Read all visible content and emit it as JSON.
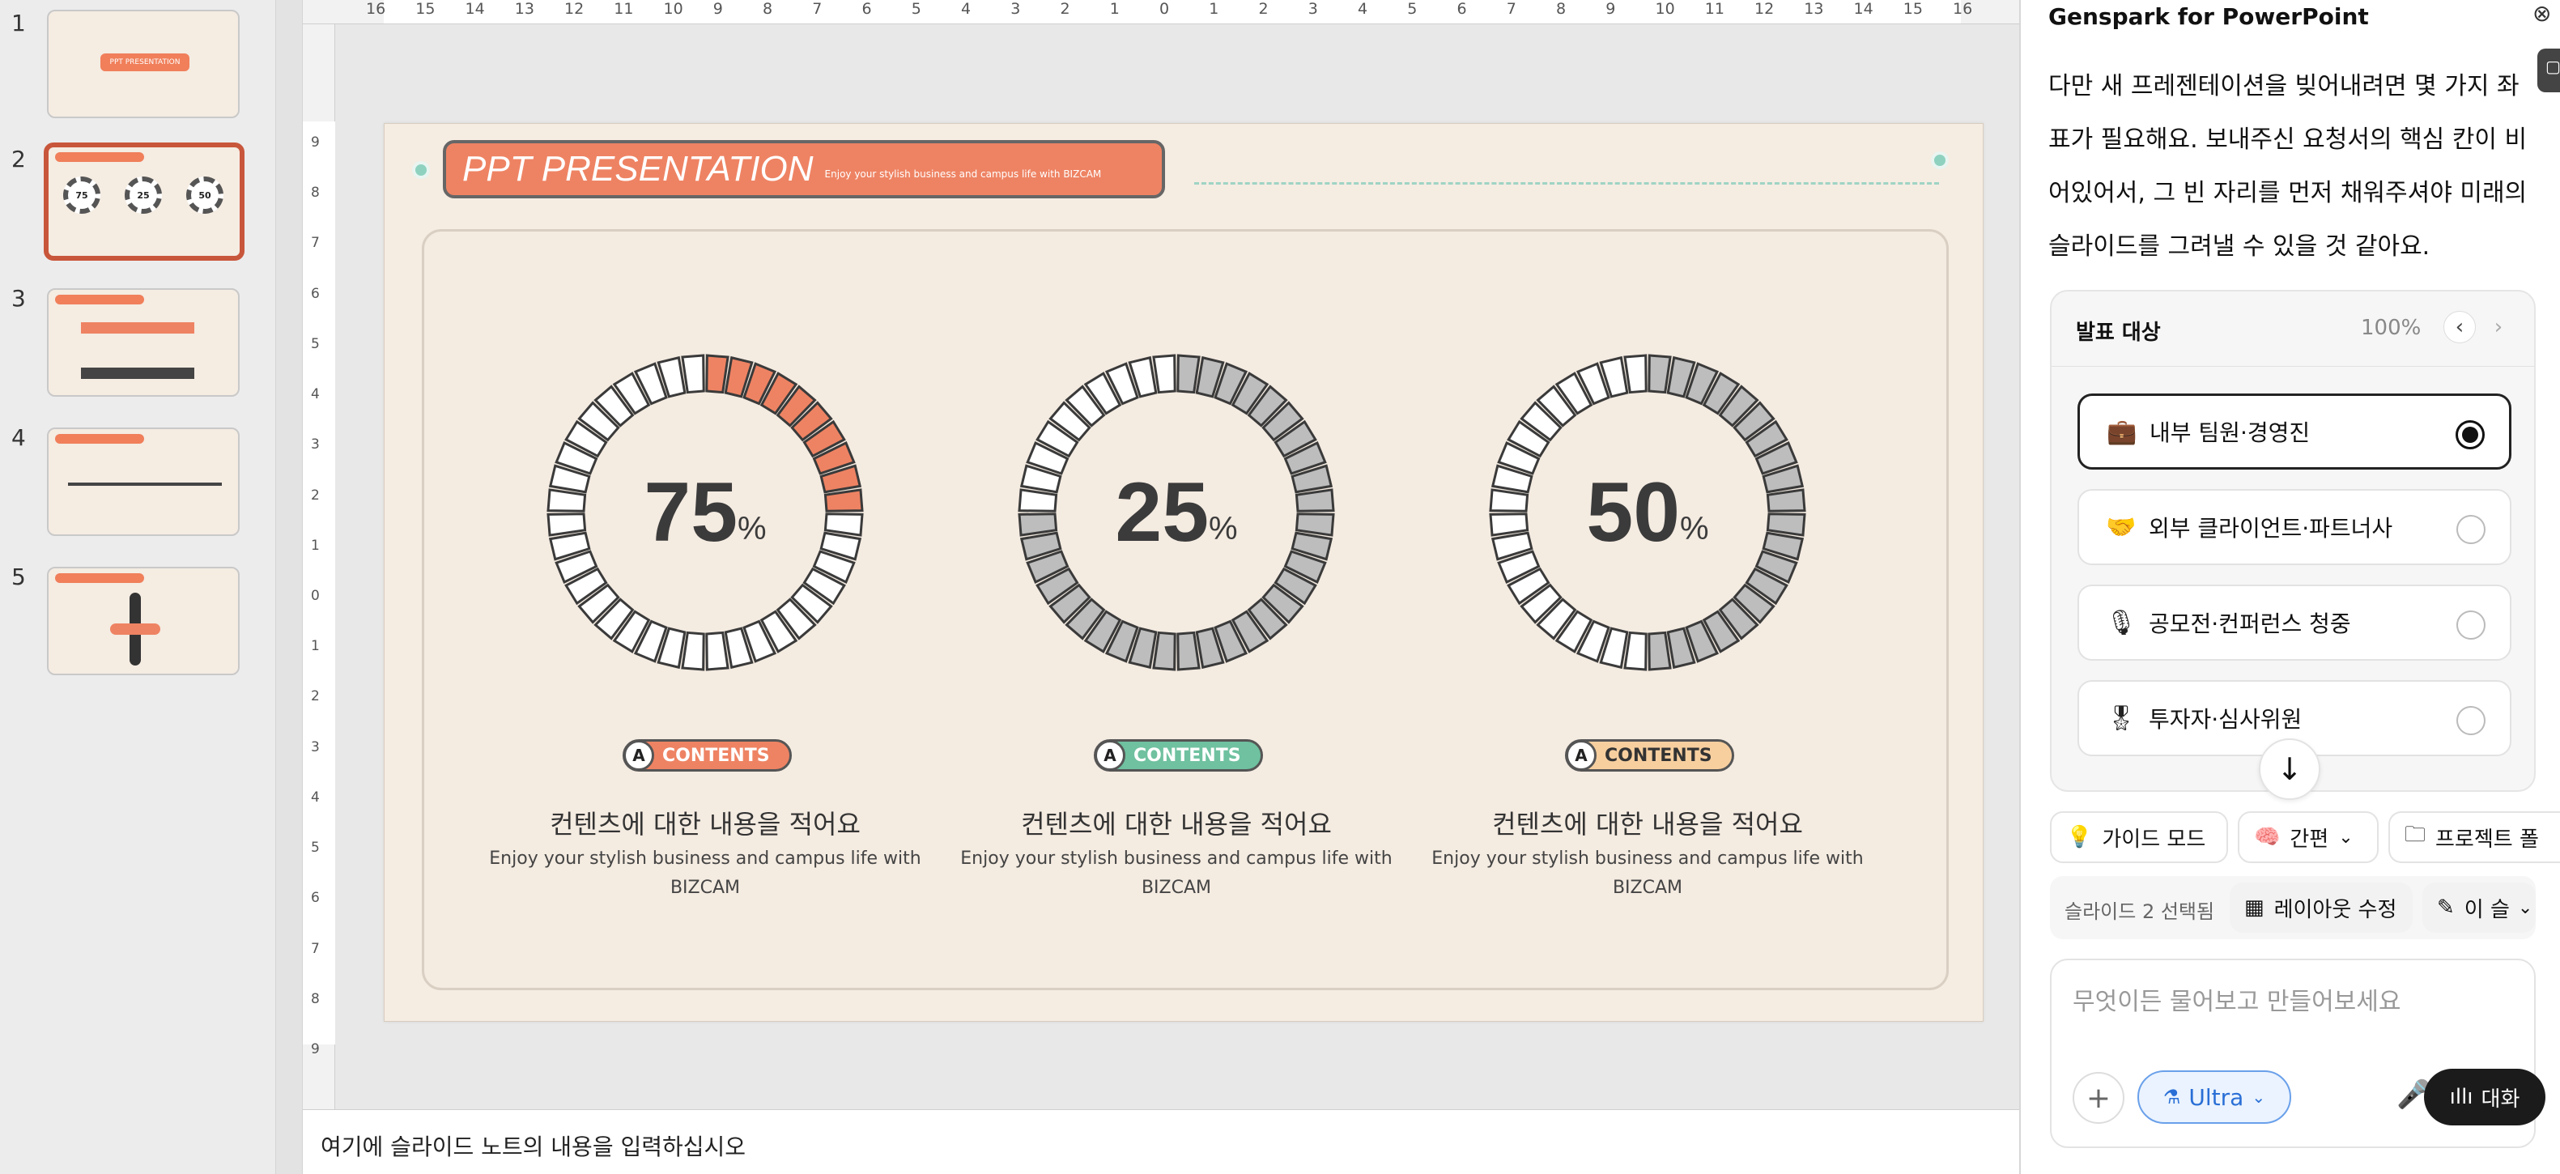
{
  "thumbnails": [
    {
      "number": "1",
      "selected": false,
      "title": "PPT PRESENTATION"
    },
    {
      "number": "2",
      "selected": true,
      "gauges": [
        "75",
        "25",
        "50"
      ]
    },
    {
      "number": "3",
      "selected": false
    },
    {
      "number": "4",
      "selected": false
    },
    {
      "number": "5",
      "selected": false
    }
  ],
  "ruler_top": [
    "16",
    "15",
    "14",
    "13",
    "12",
    "11",
    "10",
    "9",
    "8",
    "7",
    "6",
    "5",
    "4",
    "3",
    "2",
    "1",
    "0",
    "1",
    "2",
    "3",
    "4",
    "5",
    "6",
    "7",
    "8",
    "9",
    "10",
    "11",
    "12",
    "13",
    "14",
    "15",
    "16"
  ],
  "ruler_left": [
    "9",
    "8",
    "7",
    "6",
    "5",
    "4",
    "3",
    "2",
    "1",
    "0",
    "1",
    "2",
    "3",
    "4",
    "5",
    "6",
    "7",
    "8",
    "9"
  ],
  "slide": {
    "title": "PPT PRESENTATION",
    "subtitle": "Enjoy your stylish business and campus life with BIZCAM",
    "gauges": [
      {
        "value": "75",
        "unit": "%",
        "fraction": 0.25,
        "fill_color": "#ee8363",
        "pill_label": "CONTENTS",
        "pill_badge": "A",
        "pill_color": "#ee8363",
        "caption_title": "컨텐츠에 대한 내용을 적어요",
        "caption_body": "Enjoy your stylish business and campus life with BIZCAM"
      },
      {
        "value": "25",
        "unit": "%",
        "fraction": 0.75,
        "fill_color": "#bdbdbd",
        "pill_label": "CONTENTS",
        "pill_badge": "A",
        "pill_color": "#6fc19f",
        "caption_title": "컨텐츠에 대한 내용을 적어요",
        "caption_body": "Enjoy your stylish business and campus life with BIZCAM"
      },
      {
        "value": "50",
        "unit": "%",
        "fraction": 0.5,
        "fill_color": "#bdbdbd",
        "pill_label": "CONTENTS",
        "pill_badge": "A",
        "pill_color": "#f7cf9f",
        "caption_title": "컨텐츠에 대한 내용을 적어요",
        "caption_body": "Enjoy your stylish business and campus life with BIZCAM"
      }
    ]
  },
  "notes_placeholder": "여기에 슬라이드 노트의 내용을 입력하십시오",
  "panel": {
    "title": "Genspark for PowerPoint",
    "message": "다만 새 프레젠테이션을 빚어내려면 몇 가지 좌표가 필요해요. 보내주신 요청서의 핵심 칸이 비어있어서, 그 빈 자리를 먼저 채워주셔야 미래의 슬라이드를 그려낼 수 있을 것 같아요.",
    "card": {
      "title": "발표 대상",
      "progress": "100%",
      "options": [
        {
          "label": "내부 팀원·경영진",
          "icon": "briefcase-icon",
          "selected": true
        },
        {
          "label": "외부 클라이언트·파트너사",
          "icon": "handshake-icon",
          "selected": false
        },
        {
          "label": "공모전·컨퍼런스 청중",
          "icon": "microphone-icon",
          "selected": false
        },
        {
          "label": "투자자·심사위원",
          "icon": "award-icon",
          "selected": false
        }
      ]
    },
    "chips": {
      "guide": "가이드 모드",
      "brief": "간편",
      "project": "프로젝트 폴"
    },
    "selection": {
      "status": "슬라이드 2 선택됨",
      "layout": "레이아웃 수정",
      "image": "이 슬"
    },
    "input": {
      "placeholder": "무엇이든 물어보고 만들어보세요",
      "mode": "Ultra",
      "talk": "대화"
    }
  }
}
